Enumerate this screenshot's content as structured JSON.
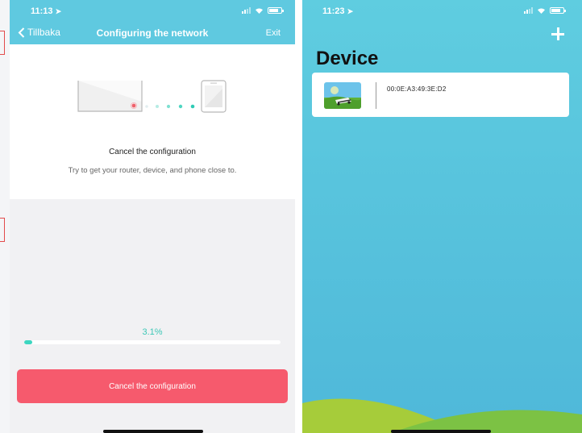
{
  "left_screen": {
    "status": {
      "time": "11:13"
    },
    "header": {
      "back_label": "Tillbaka",
      "title": "Configuring the network",
      "exit_label": "Exit"
    },
    "message": {
      "title": "Cancel the configuration",
      "subtitle": "Try to get your router, device, and phone close to."
    },
    "progress": {
      "percent_label": "3.1%",
      "fraction": 0.031
    },
    "cancel_button_label": "Cancel the configuration"
  },
  "right_screen": {
    "status": {
      "time": "11:23"
    },
    "title": "Device",
    "devices": [
      {
        "mac": "00:0E:A3:49:3E:D2"
      }
    ]
  },
  "colors": {
    "header_blue": "#5fc9e0",
    "progress_teal": "#3cd6c0",
    "cancel_red": "#f65a6d",
    "hill_green": "#a6cc3a"
  },
  "icons": [
    "location-arrow-icon",
    "signal-icon",
    "wifi-icon",
    "battery-icon",
    "chevron-left-icon",
    "plus-icon",
    "router-icon",
    "phone-icon"
  ]
}
